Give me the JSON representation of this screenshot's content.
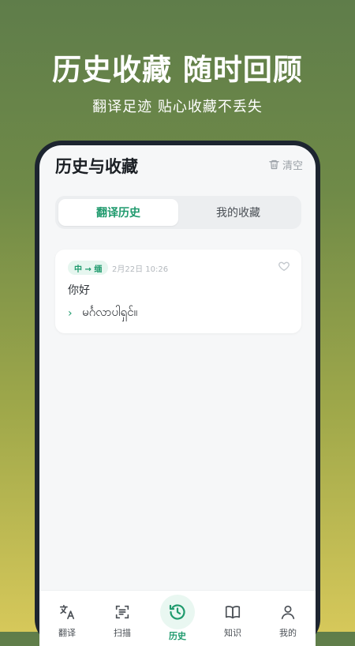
{
  "promo": {
    "title": "历史收藏 随时回顾",
    "subtitle": "翻译足迹 贴心收藏不丢失"
  },
  "header": {
    "title": "历史与收藏",
    "clear_label": "清空"
  },
  "tabs": [
    {
      "label": "翻译历史",
      "active": true
    },
    {
      "label": "我的收藏",
      "active": false
    }
  ],
  "history": [
    {
      "badge": "中 → 缅",
      "time": "2月22日 10:26",
      "source": "你好",
      "result": "မင်္ဂလာပါရှင်။"
    }
  ],
  "nav": [
    {
      "label": "翻译",
      "icon": "translate-icon"
    },
    {
      "label": "扫描",
      "icon": "scan-icon"
    },
    {
      "label": "历史",
      "icon": "history-icon",
      "active": true
    },
    {
      "label": "知识",
      "icon": "book-icon"
    },
    {
      "label": "我的",
      "icon": "user-icon"
    }
  ],
  "colors": {
    "accent": "#1f9a6d",
    "accent_bg": "#e6f6ef"
  }
}
